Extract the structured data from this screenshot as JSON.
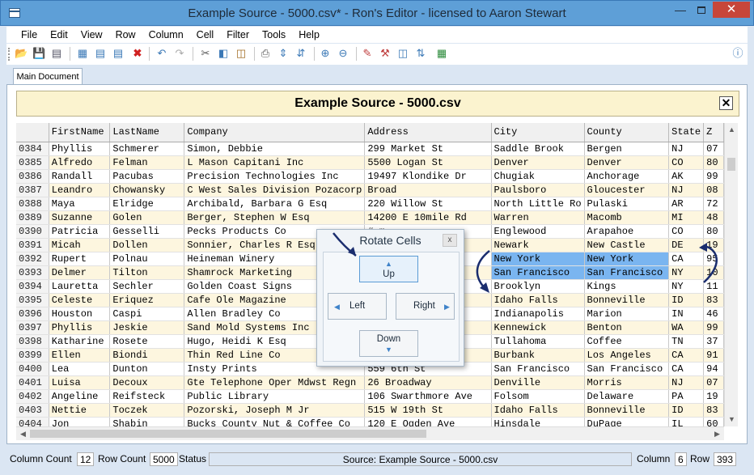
{
  "window": {
    "title": "Example Source - 5000.csv* - Ron's Editor - licensed to Aaron Stewart"
  },
  "menu": [
    "File",
    "Edit",
    "View",
    "Row",
    "Column",
    "Cell",
    "Filter",
    "Tools",
    "Help"
  ],
  "tab_label": "Main Document",
  "document_title": "Example Source - 5000.csv",
  "grid": {
    "columns": [
      "",
      "FirstName",
      "LastName",
      "Company",
      "Address",
      "City",
      "County",
      "State",
      "Z"
    ],
    "rows": [
      [
        "0384",
        "Phyllis",
        "Schmerer",
        "Simon, Debbie",
        "299 Market St",
        "Saddle Brook",
        "Bergen",
        "NJ",
        "07"
      ],
      [
        "0385",
        "Alfredo",
        "Felman",
        "L Mason Capitani Inc",
        "5500 Logan St",
        "Denver",
        "Denver",
        "CO",
        "80"
      ],
      [
        "0386",
        "Randall",
        "Pacubas",
        "Precision Technologies Inc",
        "19497 Klondike Dr",
        "Chugiak",
        "Anchorage",
        "AK",
        "99"
      ],
      [
        "0387",
        "Leandro",
        "Chowansky",
        "C West Sales Division Pozacorp",
        "Broad",
        "Paulsboro",
        "Gloucester",
        "NJ",
        "08"
      ],
      [
        "0388",
        "Maya",
        "Elridge",
        "Archibald, Barbara G Esq",
        "220 Willow St",
        "North Little Ro",
        "Pulaski",
        "AR",
        "72"
      ],
      [
        "0389",
        "Suzanne",
        "Golen",
        "Berger, Stephen W Esq",
        "14200 E 10mile Rd",
        "Warren",
        "Macomb",
        "MI",
        "48"
      ],
      [
        "0390",
        "Patricia",
        "Gesselli",
        "Pecks Products Co",
        "                  #-m",
        "Englewood",
        "Arapahoe",
        "CO",
        "80"
      ],
      [
        "0391",
        "Micah",
        "Dollen",
        "Sonnier, Charles R Esq",
        "",
        "Newark",
        "New Castle",
        "DE",
        "19"
      ],
      [
        "0392",
        "Rupert",
        "Polnau",
        "Heineman Winery",
        "",
        "New York",
        "New York",
        "CA",
        "95"
      ],
      [
        "0393",
        "Delmer",
        "Tilton",
        "Shamrock Marketing",
        "",
        "San Francisco",
        "San Francisco",
        "NY",
        "10"
      ],
      [
        "0394",
        "Lauretta",
        "Sechler",
        "Golden Coast Signs",
        "",
        "Brooklyn",
        "Kings",
        "NY",
        "11"
      ],
      [
        "0395",
        "Celeste",
        "Eriquez",
        "Cafe Ole Magazine",
        "",
        "Idaho Falls",
        "Bonneville",
        "ID",
        "83"
      ],
      [
        "0396",
        "Houston",
        "Caspi",
        "Allen Bradley Co",
        "           b Rd",
        "Indianapolis",
        "Marion",
        "IN",
        "46"
      ],
      [
        "0397",
        "Phyllis",
        "Jeskie",
        "Sand Mold Systems Inc",
        "           b Center",
        "Kennewick",
        "Benton",
        "WA",
        "99"
      ],
      [
        "0398",
        "Katharine",
        "Rosete",
        "Hugo, Heidi K Esq",
        "           St",
        "Tullahoma",
        "Coffee",
        "TN",
        "37"
      ],
      [
        "0399",
        "Ellen",
        "Biondi",
        "Thin Red Line Co",
        "           lvd",
        "Burbank",
        "Los Angeles",
        "CA",
        "91"
      ],
      [
        "0400",
        "Lea",
        "Dunton",
        "Insty Prints",
        "559 6th St",
        "San Francisco",
        "San Francisco",
        "CA",
        "94"
      ],
      [
        "0401",
        "Luisa",
        "Decoux",
        "Gte Telephone Oper Mdwst Regn",
        "26 Broadway",
        "Denville",
        "Morris",
        "NJ",
        "07"
      ],
      [
        "0402",
        "Angeline",
        "Reifsteck",
        "Public Library",
        "106 Swarthmore Ave",
        "Folsom",
        "Delaware",
        "PA",
        "19"
      ],
      [
        "0403",
        "Nettie",
        "Toczek",
        "Pozorski, Joseph M Jr",
        "515 W 19th St",
        "Idaho Falls",
        "Bonneville",
        "ID",
        "83"
      ],
      [
        "0404",
        "Jon",
        "Shabin",
        "Bucks County Nut & Coffee Co",
        "120 E Ogden Ave",
        "Hinsdale",
        "DuPage",
        "IL",
        "60"
      ]
    ],
    "highlighted_rows": [
      "0392",
      "0393"
    ]
  },
  "dialog": {
    "title": "Rotate Cells",
    "close": "x",
    "up": "Up",
    "left": "Left",
    "right": "Right",
    "down": "Down"
  },
  "status": {
    "column_count_label": "Column Count",
    "column_count": "12",
    "row_count_label": "Row Count",
    "row_count": "5000",
    "status_label": "Status",
    "source": "Source: Example Source - 5000.csv",
    "column_label": "Column",
    "column": "6",
    "row_label": "Row",
    "row": "393"
  },
  "colors": {
    "titlebar": "#5e9fd7",
    "selection": "#7ab5f0",
    "annotation_arrow": "#1a2d6e",
    "doc_title_bg": "#fbf3cf"
  }
}
